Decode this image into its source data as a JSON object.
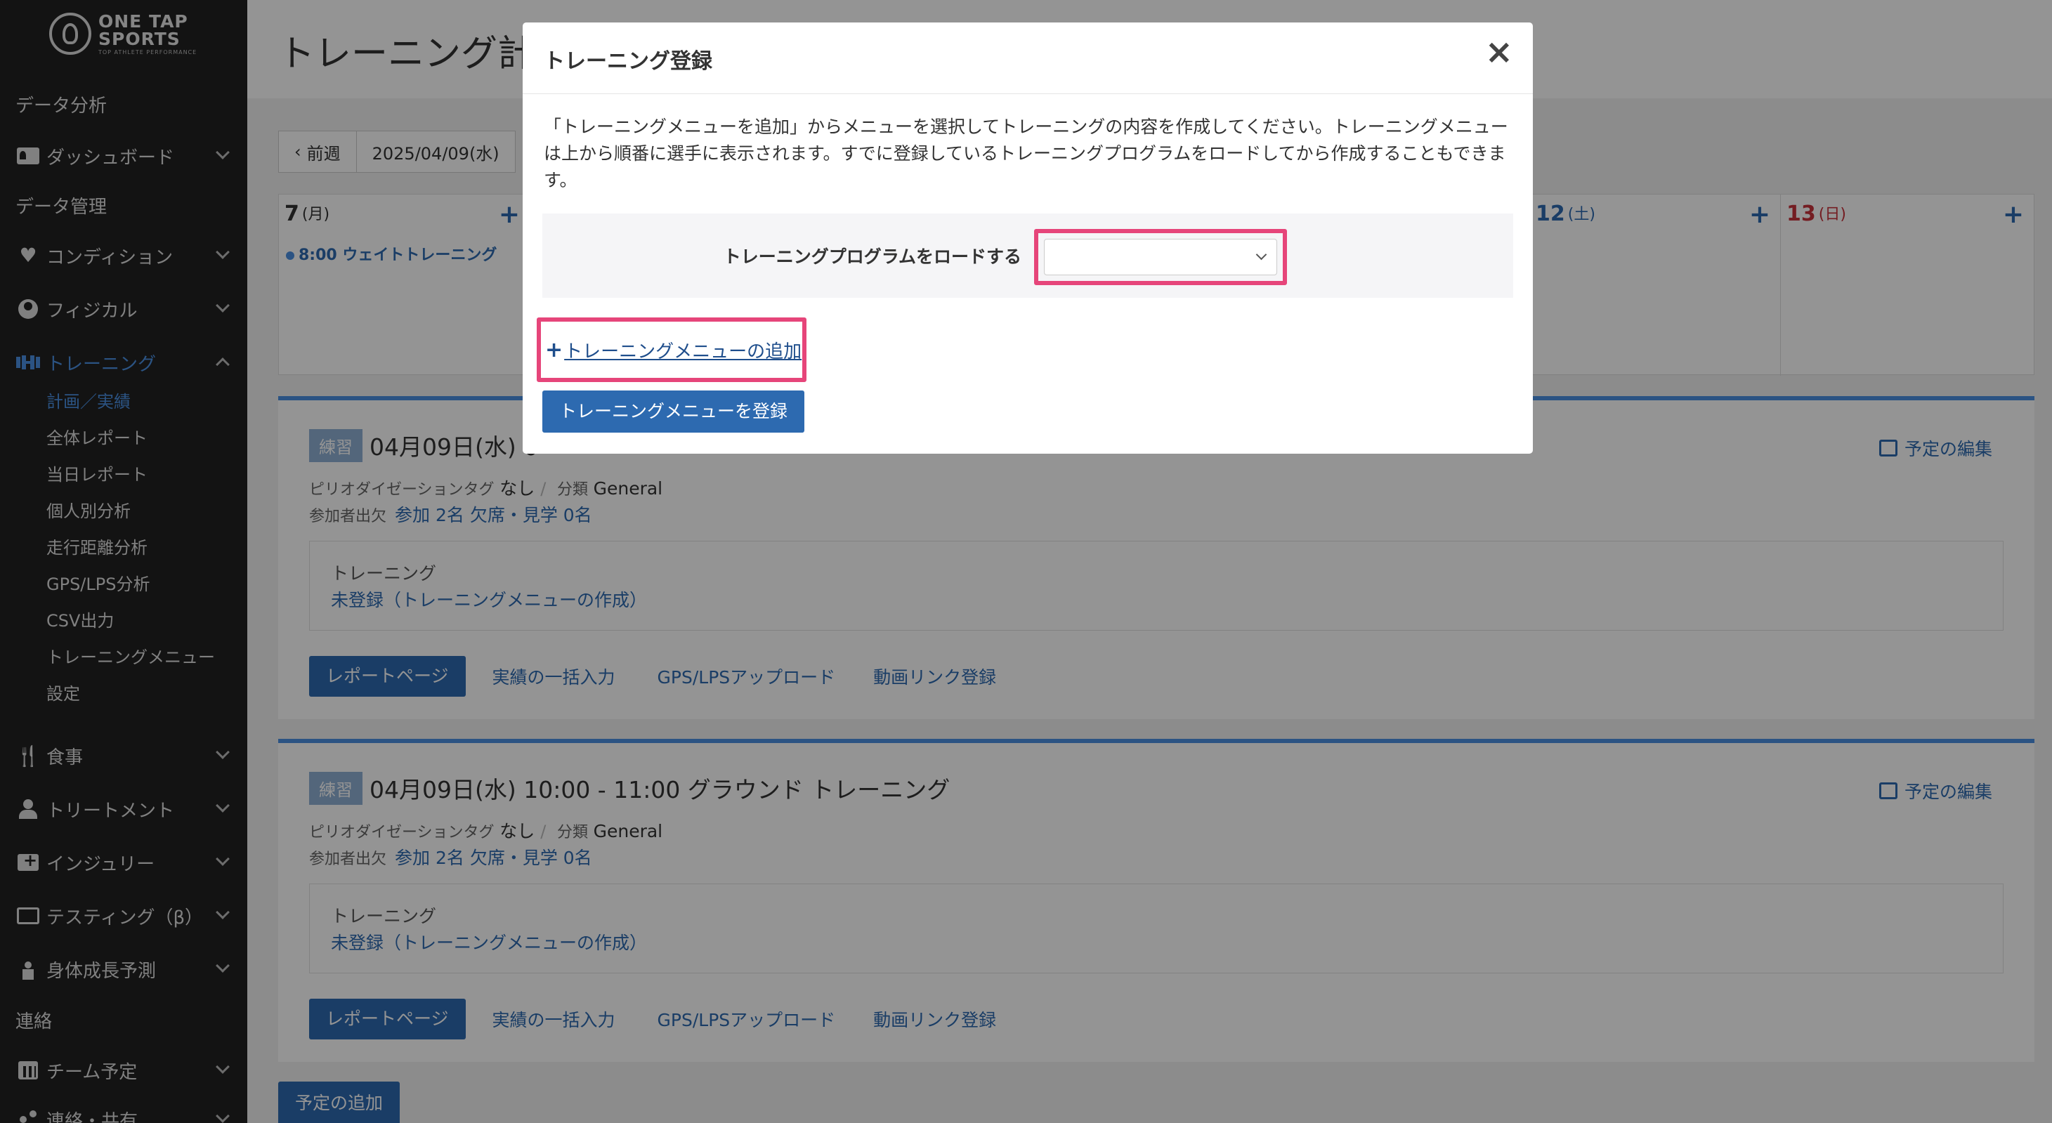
{
  "logo": {
    "line1": "ONE TAP",
    "line2": "SPORTS",
    "line3": "TOP ATHLETE PERFORMANCE"
  },
  "sidebar": {
    "section_analysis": "データ分析",
    "dashboard": "ダッシュボード",
    "section_data": "データ管理",
    "condition": "コンディション",
    "physical": "フィジカル",
    "training": "トレーニング",
    "training_sub": [
      "計画／実績",
      "全体レポート",
      "当日レポート",
      "個人別分析",
      "走行距離分析",
      "GPS/LPS分析",
      "CSV出力",
      "トレーニングメニュー",
      "設定"
    ],
    "meal": "食事",
    "treatment": "トリートメント",
    "injury": "インジュリー",
    "testing": "テスティング（β）",
    "growth": "身体成長予測",
    "section_contact": "連絡",
    "team_schedule": "チーム予定",
    "contact_share": "連絡・共有"
  },
  "main": {
    "title": "トレーニング計",
    "prev_week": "前週",
    "current_date": "2025/04/09(水)",
    "calendar": {
      "day7": {
        "num": "7",
        "dow": "(月)",
        "event": "8:00 ウェイトトレーニング"
      },
      "day12": {
        "num": "12",
        "dow": "(土)"
      },
      "day13": {
        "num": "13",
        "dow": "(日)"
      },
      "add": "+"
    },
    "events": [
      {
        "badge": "練習",
        "title": "04月09日(水) 0",
        "edit": "予定の編集",
        "period_label": "ピリオダイゼーションタグ",
        "period_value": "なし",
        "class_label": "分類",
        "class_value": "General",
        "attend_label": "参加者出欠",
        "attend_value": "参加 2名 欠席・見学 0名",
        "box_title": "トレーニング",
        "box_link": "未登録（トレーニングメニューの作成）",
        "btn_report": "レポートページ",
        "link_bulk": "実績の一括入力",
        "link_gps": "GPS/LPSアップロード",
        "link_video": "動画リンク登録"
      },
      {
        "badge": "練習",
        "title": "04月09日(水) 10:00 - 11:00 グラウンド トレーニング",
        "edit": "予定の編集",
        "period_label": "ピリオダイゼーションタグ",
        "period_value": "なし",
        "class_label": "分類",
        "class_value": "General",
        "attend_label": "参加者出欠",
        "attend_value": "参加 2名 欠席・見学 0名",
        "box_title": "トレーニング",
        "box_link": "未登録（トレーニングメニューの作成）",
        "btn_report": "レポートページ",
        "link_bulk": "実績の一括入力",
        "link_gps": "GPS/LPSアップロード",
        "link_video": "動画リンク登録"
      }
    ],
    "add_schedule": "予定の追加"
  },
  "modal": {
    "title": "トレーニング登録",
    "close": "×",
    "description": "「トレーニングメニューを追加」からメニューを選択してトレーニングの内容を作成してください。トレーニングメニューは上から順番に選手に表示されます。すでに登録しているトレーニングプログラムをロードしてから作成することもできます。",
    "load_label": "トレーニングプログラムをロードする",
    "load_value": "",
    "add_menu_plus": "+",
    "add_menu": "トレーニングメニューの追加",
    "submit": "トレーニングメニューを登録"
  },
  "colors": {
    "accent": "#2d6ab0",
    "highlight": "#e6457a",
    "sidebar_bg": "#222222",
    "sunday": "#c8323c"
  }
}
